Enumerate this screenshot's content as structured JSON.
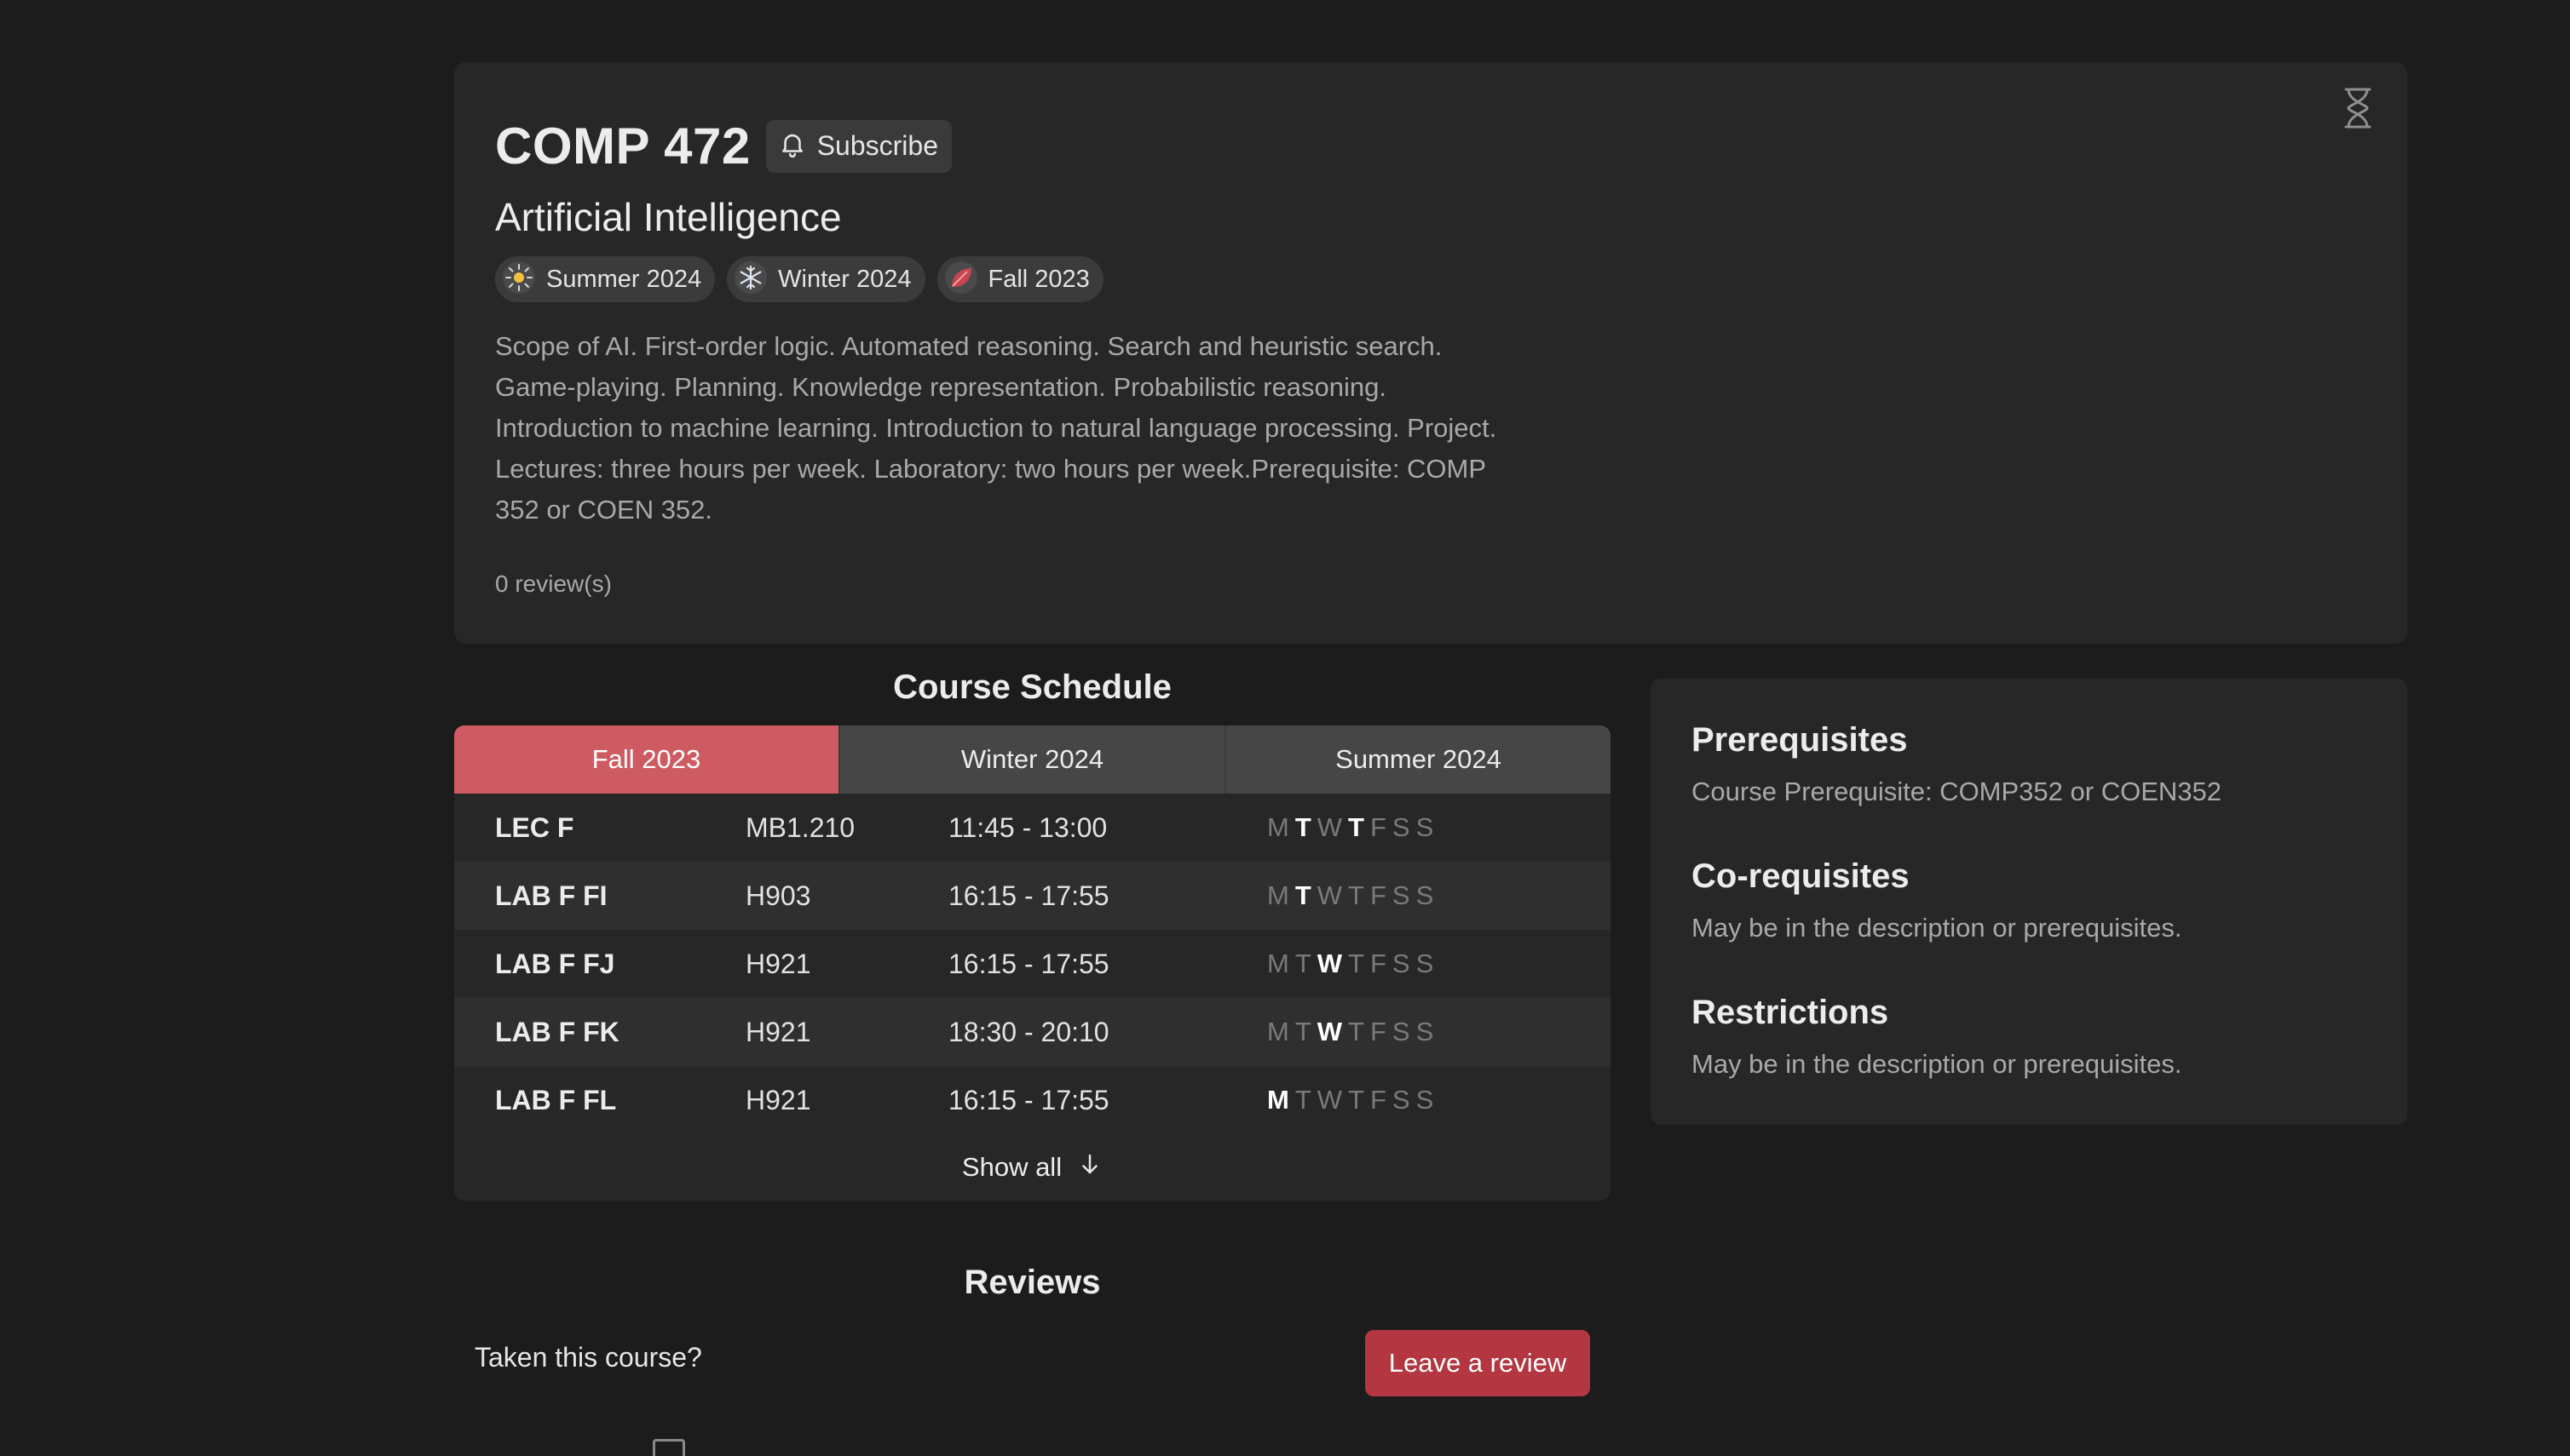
{
  "course": {
    "code": "COMP 472",
    "subscribe_label": "Subscribe",
    "title": "Artificial Intelligence",
    "terms": [
      {
        "label": "Summer 2024",
        "icon": "sun-icon"
      },
      {
        "label": "Winter 2024",
        "icon": "snowflake-icon"
      },
      {
        "label": "Fall 2023",
        "icon": "leaf-icon"
      }
    ],
    "description": "Scope of AI. First-order logic. Automated reasoning. Search and heuristic search. Game-playing. Planning. Knowledge representation. Probabilistic reasoning. Introduction to machine learning. Introduction to natural language processing. Project. Lectures: three hours per week. Laboratory: two hours per week.Prerequisite: COMP 352 or COEN 352.",
    "reviews_count": "0 review(s)"
  },
  "schedule": {
    "title": "Course Schedule",
    "tabs": [
      "Fall 2023",
      "Winter 2024",
      "Summer 2024"
    ],
    "active_tab": "Fall 2023",
    "rows": [
      {
        "section": "LEC F",
        "room": "MB1.210",
        "time": "11:45 - 13:00",
        "days_on": [
          1,
          3
        ]
      },
      {
        "section": "LAB F FI",
        "room": "H903",
        "time": "16:15 - 17:55",
        "days_on": [
          1
        ]
      },
      {
        "section": "LAB F FJ",
        "room": "H921",
        "time": "16:15 - 17:55",
        "days_on": [
          2
        ]
      },
      {
        "section": "LAB F FK",
        "room": "H921",
        "time": "18:30 - 20:10",
        "days_on": [
          2
        ]
      },
      {
        "section": "LAB F FL",
        "room": "H921",
        "time": "16:15 - 17:55",
        "days_on": [
          0
        ]
      }
    ],
    "day_letters": [
      "M",
      "T",
      "W",
      "T",
      "F",
      "S",
      "S"
    ],
    "show_all_label": "Show all"
  },
  "requirements": {
    "prerequisites_heading": "Prerequisites",
    "prerequisites_text": "Course Prerequisite: COMP352 or COEN352",
    "corequisites_heading": "Co-requisites",
    "corequisites_text": "May be in the description or prerequisites.",
    "restrictions_heading": "Restrictions",
    "restrictions_text": "May be in the description or prerequisites."
  },
  "reviews": {
    "title": "Reviews",
    "prompt": "Taken this course?",
    "leave_review_label": "Leave a review"
  },
  "colors": {
    "accent": "#cf5b62",
    "review_button": "#b33641",
    "background": "#1c1c1c",
    "card": "#272727"
  }
}
